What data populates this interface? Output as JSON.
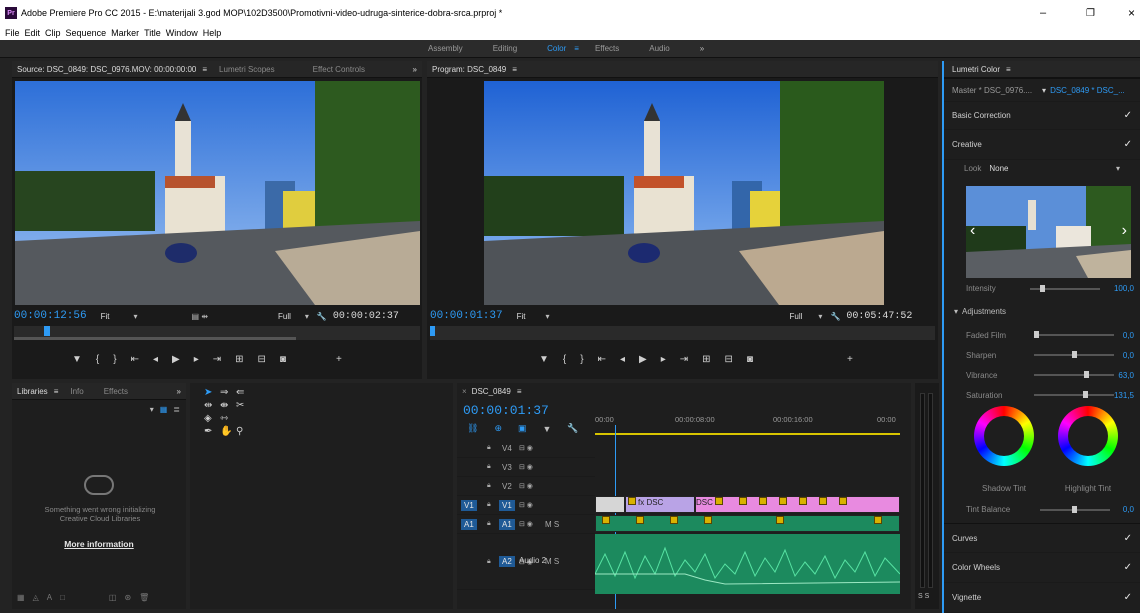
{
  "window": {
    "title": "Adobe Premiere Pro CC 2015 - E:\\materijali 3.god MOP\\102D3500\\Promotivni-video-udruga-sinterice-dobra-srca.prproj *",
    "app_icon": "Pr",
    "minimize": "–",
    "restore": "❐",
    "close": "×"
  },
  "menu": [
    "File",
    "Edit",
    "Clip",
    "Sequence",
    "Marker",
    "Title",
    "Window",
    "Help"
  ],
  "workspaces": [
    {
      "label": "Assembly"
    },
    {
      "label": "Editing"
    },
    {
      "label": "Color",
      "active": true
    },
    {
      "label": "Effects"
    },
    {
      "label": "Audio"
    }
  ],
  "workspace_more": "»",
  "workspace_menu": "≡",
  "source": {
    "tab": "Source: DSC_0849: DSC_0976.MOV: 00:00:00:00",
    "menu": "≡",
    "tab2": "Lumetri Scopes",
    "tab3": "Effect Controls",
    "more": "»",
    "timecode": "00:00:12:56",
    "fit": "Fit",
    "quality": "Full",
    "duration": "00:00:02:37"
  },
  "program": {
    "tab": "Program: DSC_0849",
    "menu": "≡",
    "timecode": "00:00:01:37",
    "fit": "Fit",
    "quality": "Full",
    "duration": "00:05:47:52"
  },
  "libraries": {
    "tab": "Libraries",
    "menu": "≡",
    "tab2": "Info",
    "tab3": "Effects",
    "more": "»",
    "error": "Something went wrong initializing Creative Cloud Libraries",
    "link": "More information"
  },
  "timeline": {
    "tab": "DSC_0849",
    "close": "×",
    "menu": "≡",
    "timecode": "00:00:01:37",
    "ruler": [
      "00:00",
      "00:00:08:00",
      "00:00:16:00",
      "00:00"
    ],
    "tracks": [
      {
        "name": "V4"
      },
      {
        "name": "V3"
      },
      {
        "name": "V2"
      },
      {
        "name": "V1",
        "src": "V1"
      },
      {
        "name": "A1",
        "src": "A1",
        "extra": "M S"
      },
      {
        "name": "A2",
        "extra": "M S",
        "label": "Audio 2"
      }
    ],
    "clip_labels": [
      "fx",
      "fx DSC",
      "DSC"
    ],
    "meter": "S S"
  },
  "lumetri": {
    "tab": "Lumetri Color",
    "menu": "≡",
    "master": "Master * DSC_0976....",
    "sequence": "DSC_0849 * DSC_...",
    "basic": "Basic Correction",
    "creative": "Creative",
    "look_label": "Look",
    "look_value": "None",
    "intensity_label": "Intensity",
    "intensity_value": "100,0",
    "adjustments": "Adjustments",
    "sliders": [
      {
        "label": "Faded Film",
        "value": "0,0",
        "level": 0.0
      },
      {
        "label": "Sharpen",
        "value": "0,0",
        "level": 0.5
      },
      {
        "label": "Vibrance",
        "value": "63,0",
        "level": 0.66
      },
      {
        "label": "Saturation",
        "value": "131,5",
        "level": 0.66
      }
    ],
    "shadow_tint": "Shadow Tint",
    "highlight_tint": "Highlight Tint",
    "tint_balance_label": "Tint Balance",
    "tint_balance_value": "0,0",
    "curves": "Curves",
    "wheels": "Color Wheels",
    "vignette": "Vignette",
    "checkmark": "✓"
  }
}
